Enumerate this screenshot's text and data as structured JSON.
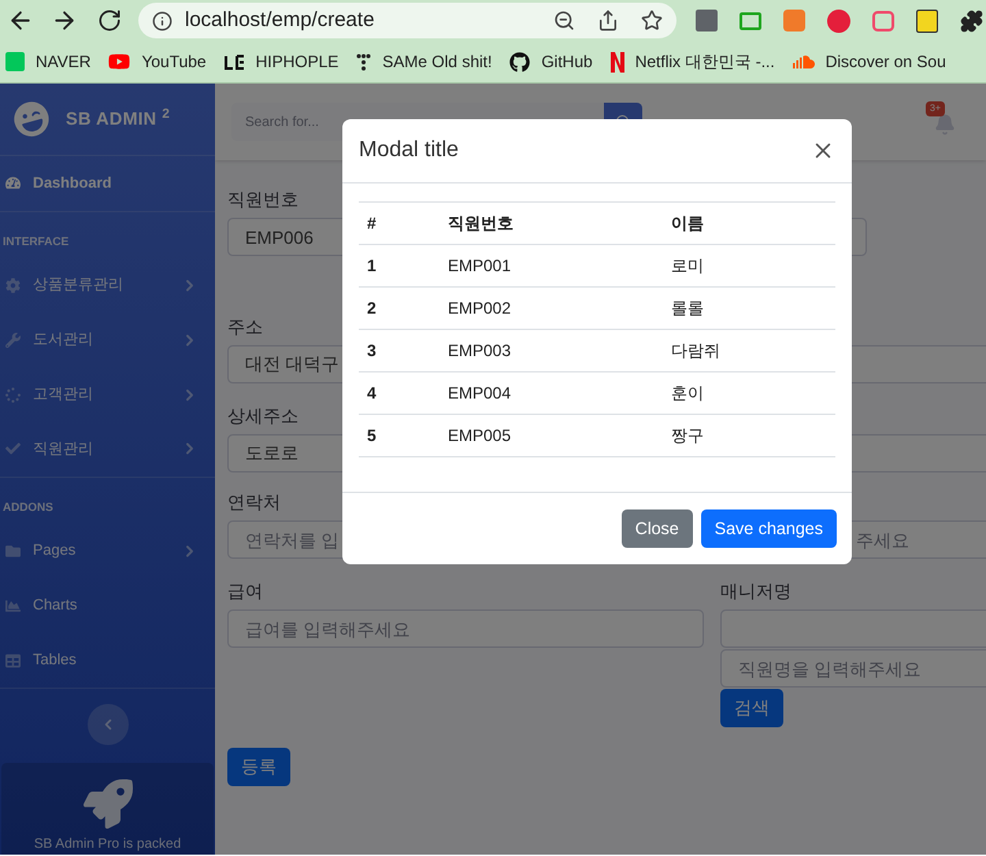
{
  "browser": {
    "address": "localhost/emp/create",
    "extensions": [
      {
        "kind": "reader"
      },
      {
        "kind": "screen"
      },
      {
        "kind": "ex"
      },
      {
        "kind": "abp"
      },
      {
        "kind": "chat"
      },
      {
        "kind": "js"
      },
      {
        "kind": "puzzle"
      }
    ],
    "bookmarks": [
      {
        "label": "NAVER",
        "kind": "naver"
      },
      {
        "label": "YouTube",
        "kind": "youtube"
      },
      {
        "label": "HIPHOPLE",
        "kind": "lg"
      },
      {
        "label": "SAMe Old shit!",
        "kind": "dots"
      },
      {
        "label": "GitHub",
        "kind": "github"
      },
      {
        "label": "Netflix 대한민국 -...",
        "kind": "netflix"
      },
      {
        "label": "Discover on Sou",
        "kind": "soundcloud"
      }
    ]
  },
  "sidebar": {
    "brand": "SB ADMIN",
    "brand_sup": "2",
    "items": [
      {
        "kind": "link",
        "label": "Dashboard",
        "selected": true,
        "expandable": false
      },
      {
        "kind": "heading",
        "label": "INTERFACE"
      },
      {
        "kind": "link",
        "label": "상품분류관리",
        "selected": false,
        "expandable": true
      },
      {
        "kind": "link",
        "label": "도서관리",
        "selected": false,
        "expandable": true
      },
      {
        "kind": "link",
        "label": "고객관리",
        "selected": false,
        "expandable": true
      },
      {
        "kind": "link",
        "label": "직원관리",
        "selected": false,
        "expandable": true
      },
      {
        "kind": "heading",
        "label": "ADDONS"
      },
      {
        "kind": "link",
        "label": "Pages",
        "selected": false,
        "expandable": true
      },
      {
        "kind": "link",
        "label": "Charts",
        "selected": false,
        "expandable": false
      },
      {
        "kind": "link",
        "label": "Tables",
        "selected": false,
        "expandable": false
      }
    ],
    "promo": "SB Admin Pro is packed"
  },
  "topbar": {
    "search_placeholder": "Search for...",
    "alerts_badge": "3+"
  },
  "form": {
    "emp_no": {
      "label": "직원번호",
      "value": "EMP006"
    },
    "address": {
      "label": "주소",
      "value": "대전 대덕구"
    },
    "address_detail": {
      "label": "상세주소",
      "value": "도로로"
    },
    "contact": {
      "label": "연락처",
      "placeholder": "연락처를 입"
    },
    "contact_right": {
      "placeholder": "주세요"
    },
    "salary": {
      "label": "급여",
      "placeholder": "급여를 입력해주세요"
    },
    "manager": {
      "label": "매니저명",
      "search_placeholder": "직원명을 입력해주세요",
      "search_button": "검색"
    },
    "submit": "등록"
  },
  "modal": {
    "title": "Modal title",
    "table": {
      "columns": [
        "#",
        "직원번호",
        "이름"
      ],
      "rows": [
        [
          "1",
          "EMP001",
          "로미"
        ],
        [
          "2",
          "EMP002",
          "롤롤"
        ],
        [
          "3",
          "EMP003",
          "다람쥐"
        ],
        [
          "4",
          "EMP004",
          "훈이"
        ],
        [
          "5",
          "EMP005",
          "짱구"
        ]
      ]
    },
    "close_button": "Close",
    "save_button": "Save changes"
  }
}
